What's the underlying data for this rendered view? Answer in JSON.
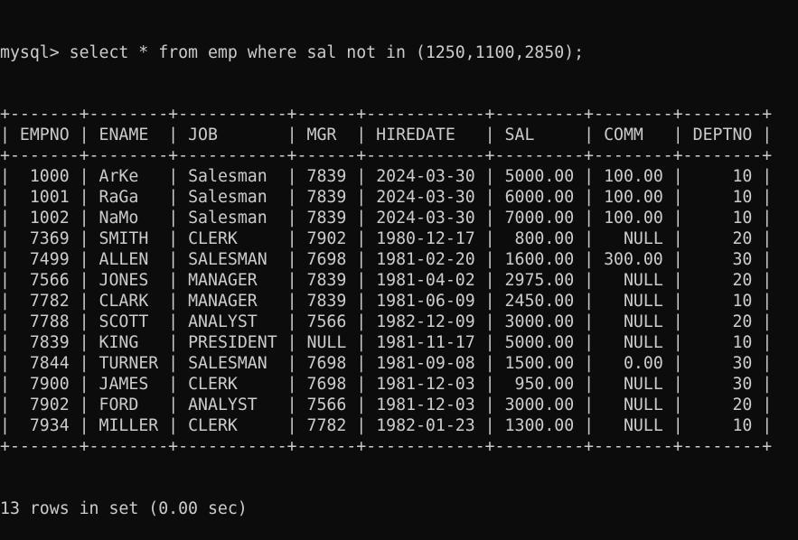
{
  "terminal": {
    "prompt": "mysql> ",
    "command": "select * from emp where sal not in (1250,1100,2850);",
    "footer": "13 rows in set (0.00 sec)",
    "colors": {
      "background": "#0c0c0c",
      "foreground": "#cccccc"
    }
  },
  "table": {
    "headers": [
      "EMPNO",
      "ENAME",
      "JOB",
      "MGR",
      "HIREDATE",
      "SAL",
      "COMM",
      "DEPTNO"
    ],
    "rows": [
      [
        "1000",
        "ArKe",
        "Salesman",
        "7839",
        "2024-03-30",
        "5000.00",
        "100.00",
        "10"
      ],
      [
        "1001",
        "RaGa",
        "Salesman",
        "7839",
        "2024-03-30",
        "6000.00",
        "100.00",
        "10"
      ],
      [
        "1002",
        "NaMo",
        "Salesman",
        "7839",
        "2024-03-30",
        "7000.00",
        "100.00",
        "10"
      ],
      [
        "7369",
        "SMITH",
        "CLERK",
        "7902",
        "1980-12-17",
        "800.00",
        "NULL",
        "20"
      ],
      [
        "7499",
        "ALLEN",
        "SALESMAN",
        "7698",
        "1981-02-20",
        "1600.00",
        "300.00",
        "30"
      ],
      [
        "7566",
        "JONES",
        "MANAGER",
        "7839",
        "1981-04-02",
        "2975.00",
        "NULL",
        "20"
      ],
      [
        "7782",
        "CLARK",
        "MANAGER",
        "7839",
        "1981-06-09",
        "2450.00",
        "NULL",
        "10"
      ],
      [
        "7788",
        "SCOTT",
        "ANALYST",
        "7566",
        "1982-12-09",
        "3000.00",
        "NULL",
        "20"
      ],
      [
        "7839",
        "KING",
        "PRESIDENT",
        "NULL",
        "1981-11-17",
        "5000.00",
        "NULL",
        "10"
      ],
      [
        "7844",
        "TURNER",
        "SALESMAN",
        "7698",
        "1981-09-08",
        "1500.00",
        "0.00",
        "30"
      ],
      [
        "7900",
        "JAMES",
        "CLERK",
        "7698",
        "1981-12-03",
        "950.00",
        "NULL",
        "30"
      ],
      [
        "7902",
        "FORD",
        "ANALYST",
        "7566",
        "1981-12-03",
        "3000.00",
        "NULL",
        "20"
      ],
      [
        "7934",
        "MILLER",
        "CLERK",
        "7782",
        "1982-01-23",
        "1300.00",
        "NULL",
        "10"
      ]
    ]
  }
}
